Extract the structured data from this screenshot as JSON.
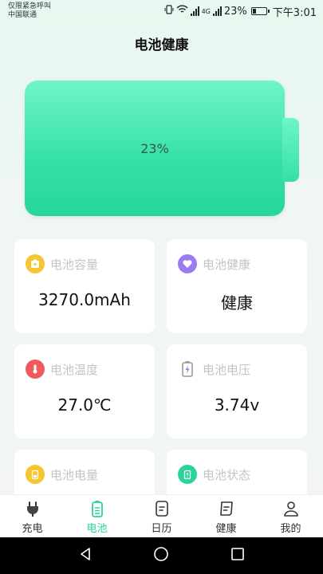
{
  "status_bar": {
    "carrier_line1": "仅限紧急呼叫",
    "carrier_line2": "中国联通",
    "network": "4G",
    "battery_percent": "23%",
    "time": "下午3:01"
  },
  "page": {
    "title": "电池健康"
  },
  "battery": {
    "percent": "23%",
    "level": 0.23,
    "color": "#35e0a8"
  },
  "cards": [
    {
      "label": "电池容量",
      "value": "3270.0mAh",
      "icon": "battery-capacity-icon",
      "color": "#f7c531"
    },
    {
      "label": "电池健康",
      "value": "健康",
      "icon": "heart-icon",
      "color": "#9c7bf0"
    },
    {
      "label": "电池温度",
      "value": "27.0℃",
      "icon": "thermometer-icon",
      "color": "#f05a5a"
    },
    {
      "label": "电池电压",
      "value": "3.74v",
      "icon": "voltage-icon",
      "color": "#9a9a9a"
    },
    {
      "label": "电池电量",
      "value": "",
      "icon": "battery-level-icon",
      "color": "#f7c531"
    },
    {
      "label": "电池状态",
      "value": "",
      "icon": "battery-status-icon",
      "color": "#2ad39b"
    }
  ],
  "tabs": [
    {
      "label": "充电",
      "icon": "plug-icon"
    },
    {
      "label": "电池",
      "icon": "battery-tab-icon",
      "active": true
    },
    {
      "label": "日历",
      "icon": "calendar-icon"
    },
    {
      "label": "健康",
      "icon": "health-icon"
    },
    {
      "label": "我的",
      "icon": "user-icon"
    }
  ],
  "colors": {
    "accent": "#2ad39b"
  }
}
